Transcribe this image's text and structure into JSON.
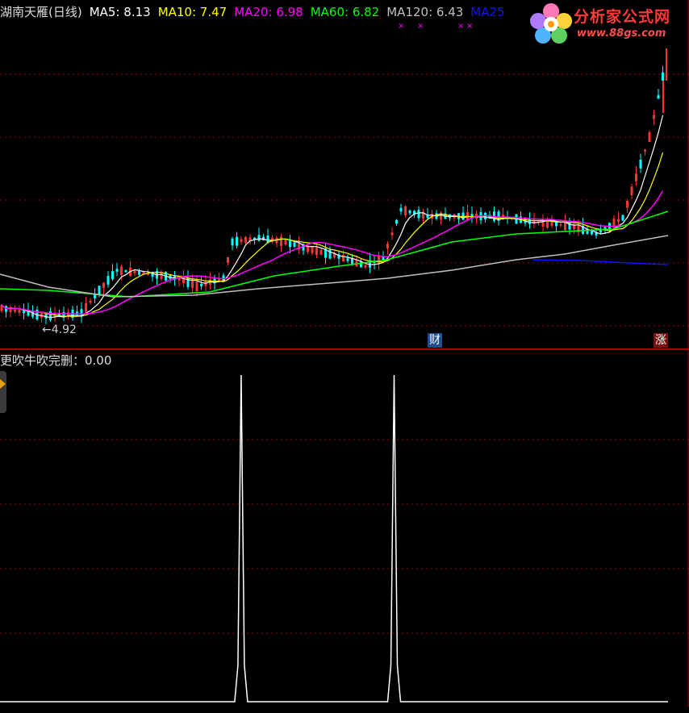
{
  "title": "湖南天雁(日线)",
  "ma_legend": [
    {
      "label": "MA5: 8.13",
      "color": "#ffffff"
    },
    {
      "label": "MA10: 7.47",
      "color": "#ffff00"
    },
    {
      "label": "MA20: 6.98",
      "color": "#ff00ff"
    },
    {
      "label": "MA60: 6.82",
      "color": "#00ff00"
    },
    {
      "label": "MA120: 6.43",
      "color": "#c0c0c0"
    },
    {
      "label": "MA25",
      "color": "#1010ff"
    }
  ],
  "indicator_label": "更吹牛吹完删：0.00",
  "low_marker": "←4.92",
  "tags": {
    "cai": "财",
    "zhang": "涨"
  },
  "logo": {
    "text": "分析家公式网",
    "url": "www.88gs.com"
  },
  "colors": {
    "up": "#ff3232",
    "down": "#00ffff",
    "grid": "#8b0000",
    "ma5": "#ffffff",
    "ma10": "#ffff00",
    "ma20": "#ff00ff",
    "ma60": "#00ff00",
    "ma120": "#c0c0c0",
    "ma250": "#1010ff"
  },
  "chart_data": [
    {
      "type": "line",
      "name": "candlestick-main",
      "ylim": [
        4.5,
        11.0
      ],
      "low_value": 4.92,
      "ma5_last": 8.13,
      "ma10_last": 7.47,
      "ma20_last": 6.98,
      "ma60_last": 6.82,
      "ma120_last": 6.43
    },
    {
      "type": "line",
      "name": "indicator",
      "value": 0.0,
      "ylim": [
        0,
        1
      ],
      "spikes_at": [
        0.35,
        0.572
      ]
    }
  ]
}
